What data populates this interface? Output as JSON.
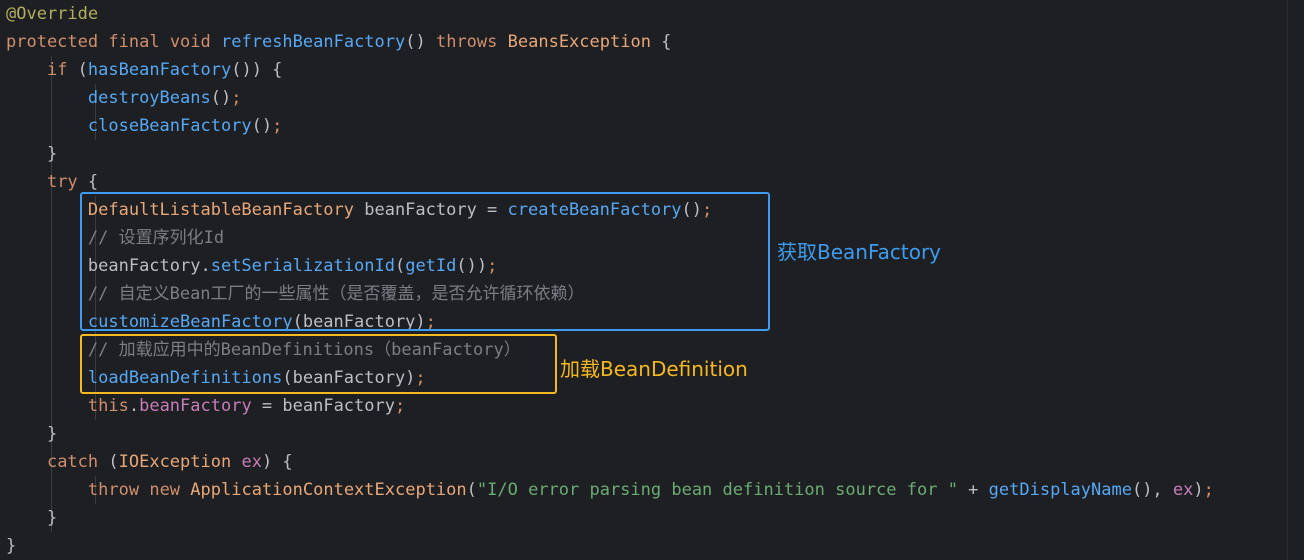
{
  "editor": {
    "theme_bg": "#1e1f22",
    "lines": [
      [
        {
          "t": "@Override",
          "c": "anno"
        }
      ],
      [
        {
          "t": "protected",
          "c": "kw"
        },
        {
          "t": " "
        },
        {
          "t": "final",
          "c": "kw"
        },
        {
          "t": " "
        },
        {
          "t": "void",
          "c": "kw"
        },
        {
          "t": " "
        },
        {
          "t": "refreshBeanFactory",
          "c": "fn"
        },
        {
          "t": "() ",
          "c": "pn"
        },
        {
          "t": "throws",
          "c": "kw"
        },
        {
          "t": " "
        },
        {
          "t": "BeansException",
          "c": "ty"
        },
        {
          "t": " {",
          "c": "pn"
        }
      ],
      [
        {
          "t": "    "
        },
        {
          "t": "if",
          "c": "kw"
        },
        {
          "t": " (",
          "c": "pn"
        },
        {
          "t": "hasBeanFactory",
          "c": "fn"
        },
        {
          "t": "()) {",
          "c": "pn"
        }
      ],
      [
        {
          "t": "        "
        },
        {
          "t": "destroyBeans",
          "c": "fn"
        },
        {
          "t": "()",
          "c": "pn"
        },
        {
          "t": ";",
          "c": "sc"
        }
      ],
      [
        {
          "t": "        "
        },
        {
          "t": "closeBeanFactory",
          "c": "fn"
        },
        {
          "t": "()",
          "c": "pn"
        },
        {
          "t": ";",
          "c": "sc"
        }
      ],
      [
        {
          "t": "    }",
          "c": "pn"
        }
      ],
      [
        {
          "t": "    "
        },
        {
          "t": "try",
          "c": "kw"
        },
        {
          "t": " {",
          "c": "pn"
        }
      ],
      [
        {
          "t": "        "
        },
        {
          "t": "DefaultListableBeanFactory",
          "c": "ty"
        },
        {
          "t": " beanFactory = ",
          "c": "id"
        },
        {
          "t": "createBeanFactory",
          "c": "fn"
        },
        {
          "t": "()",
          "c": "pn"
        },
        {
          "t": ";",
          "c": "sc"
        }
      ],
      [
        {
          "t": "        "
        },
        {
          "t": "// 设置序列化Id",
          "c": "cm"
        }
      ],
      [
        {
          "t": "        "
        },
        {
          "t": "beanFactory.",
          "c": "id"
        },
        {
          "t": "setSerializationId",
          "c": "fn"
        },
        {
          "t": "(",
          "c": "pn"
        },
        {
          "t": "getId",
          "c": "fn"
        },
        {
          "t": "())",
          "c": "pn"
        },
        {
          "t": ";",
          "c": "sc"
        }
      ],
      [
        {
          "t": "        "
        },
        {
          "t": "// 自定义Bean工厂的一些属性（是否覆盖，是否允许循环依赖）",
          "c": "cm"
        }
      ],
      [
        {
          "t": "        "
        },
        {
          "t": "customizeBeanFactory",
          "c": "fn"
        },
        {
          "t": "(beanFactory)",
          "c": "id"
        },
        {
          "t": ";",
          "c": "sc"
        }
      ],
      [
        {
          "t": "        "
        },
        {
          "t": "// 加载应用中的BeanDefinitions（beanFactory）",
          "c": "cm"
        }
      ],
      [
        {
          "t": "        "
        },
        {
          "t": "loadBeanDefinitions",
          "c": "fn"
        },
        {
          "t": "(beanFactory)",
          "c": "id"
        },
        {
          "t": ";",
          "c": "sc"
        }
      ],
      [
        {
          "t": "        "
        },
        {
          "t": "this",
          "c": "kw"
        },
        {
          "t": ".",
          "c": "pn"
        },
        {
          "t": "beanFactory",
          "c": "fld"
        },
        {
          "t": " = beanFactory",
          "c": "id"
        },
        {
          "t": ";",
          "c": "sc"
        }
      ],
      [
        {
          "t": "    }",
          "c": "pn"
        }
      ],
      [
        {
          "t": "    "
        },
        {
          "t": "catch",
          "c": "kw"
        },
        {
          "t": " (",
          "c": "pn"
        },
        {
          "t": "IOException",
          "c": "ty"
        },
        {
          "t": " "
        },
        {
          "t": "ex",
          "c": "var"
        },
        {
          "t": ") {",
          "c": "pn"
        }
      ],
      [
        {
          "t": "        "
        },
        {
          "t": "throw",
          "c": "kw"
        },
        {
          "t": " "
        },
        {
          "t": "new",
          "c": "kw"
        },
        {
          "t": " "
        },
        {
          "t": "ApplicationContextException",
          "c": "ty"
        },
        {
          "t": "(",
          "c": "pn"
        },
        {
          "t": "\"I/O error parsing bean definition source for \"",
          "c": "str"
        },
        {
          "t": " + ",
          "c": "pn"
        },
        {
          "t": "getDisplayName",
          "c": "fn"
        },
        {
          "t": "(), ",
          "c": "pn"
        },
        {
          "t": "ex",
          "c": "var"
        },
        {
          "t": ")",
          "c": "pn"
        },
        {
          "t": ";",
          "c": "sc"
        }
      ],
      [
        {
          "t": "    }",
          "c": "pn"
        }
      ],
      [
        {
          "t": "}",
          "c": "pn"
        }
      ]
    ]
  },
  "annotations": {
    "box1": {
      "label": "获取BeanFactory",
      "color": "#3d9cf0"
    },
    "box2": {
      "label": "加载BeanDefinition",
      "color": "#f5b820"
    }
  }
}
